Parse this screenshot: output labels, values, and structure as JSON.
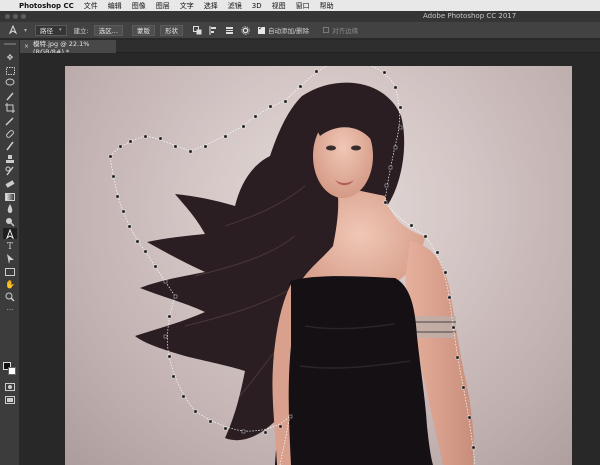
{
  "menubar": {
    "apple_icon": "apple-icon",
    "items": [
      "Photoshop CC",
      "文件",
      "编辑",
      "图像",
      "图层",
      "文字",
      "选择",
      "滤镜",
      "3D",
      "视图",
      "窗口",
      "帮助"
    ]
  },
  "window": {
    "title": "Adobe Photoshop CC 2017"
  },
  "options_bar": {
    "tool_icon": "pen-icon",
    "mode_select": "路径",
    "build_label": "建立:",
    "selection_button": "选区...",
    "mask_button": "蒙版",
    "shape_button": "形状",
    "auto_add_delete_label": "自动添加/删除",
    "align_edges_label": "对齐边缘",
    "icons": [
      "path-operations-icon",
      "path-alignment-icon",
      "path-arrangement-icon",
      "gear-icon"
    ]
  },
  "document_tab": {
    "title": "模特.jpg @ 22.1%(RGB/8#) *",
    "close": "×"
  },
  "toolbar": {
    "tools": [
      "move-icon",
      "marquee-icon",
      "lasso-icon",
      "quick-select-icon",
      "crop-icon",
      "eyedropper-icon",
      "healing-brush-icon",
      "brush-icon",
      "clone-stamp-icon",
      "history-brush-icon",
      "eraser-icon",
      "gradient-icon",
      "blur-icon",
      "dodge-icon",
      "pen-icon",
      "type-icon",
      "path-select-icon",
      "rectangle-icon",
      "hand-icon",
      "zoom-icon",
      "more-tools-icon"
    ],
    "foreground_color": "#111111",
    "background_color": "#ffffff"
  },
  "colors": {
    "accent_menubar": "#e8e8e8",
    "panel": "#424242",
    "canvas_bg": "#282828"
  }
}
